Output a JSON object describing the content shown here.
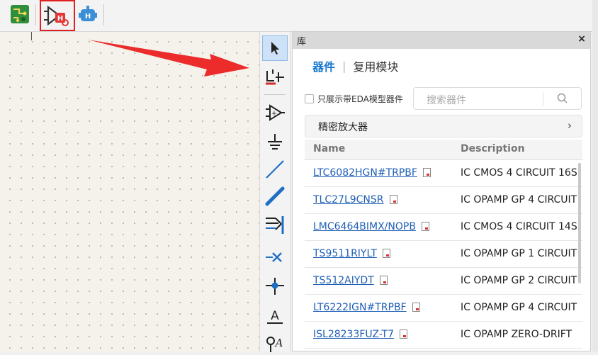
{
  "toolbar": {
    "items": [
      {
        "name": "pcb-board-icon",
        "selected": false
      },
      {
        "name": "schematic-library-icon",
        "selected": true,
        "highlight_color": "#e02020"
      },
      {
        "name": "robot-helper-icon",
        "selected": false
      }
    ]
  },
  "vertical_tools": [
    "select-arrow-icon",
    "bus-entry-icon",
    "add-symbol-icon",
    "ground-power-icon",
    "wire-icon",
    "bus-icon",
    "bus-entry-multi-icon",
    "no-connect-icon",
    "junction-icon",
    "text-label-icon",
    "net-label-icon"
  ],
  "panel": {
    "title": "库",
    "close_label": "×",
    "tabs": {
      "active": "器件",
      "separator": "|",
      "inactive": "复用模块"
    },
    "checkbox_label": "只展示带EDA模型器件",
    "checkbox_checked": false,
    "search_placeholder": "搜索器件",
    "category": {
      "label": "精密放大器",
      "chevron": "›"
    },
    "table": {
      "headers": {
        "name": "Name",
        "description": "Description"
      },
      "rows": [
        {
          "name": "LTC6082HGN#TRPBF",
          "description": "IC CMOS 4 CIRCUIT 16S"
        },
        {
          "name": "TLC27L9CNSR",
          "description": "IC OPAMP GP 4 CIRCUIT"
        },
        {
          "name": "LMC6464BIMX/NOPB",
          "description": "IC CMOS 4 CIRCUIT 14S"
        },
        {
          "name": "TS9511RIYLT",
          "description": "IC OPAMP GP 1 CIRCUIT"
        },
        {
          "name": "TS512AIYDT",
          "description": "IC OPAMP GP 2 CIRCUIT"
        },
        {
          "name": "LT6222IGN#TRPBF",
          "description": "IC OPAMP GP 4 CIRCUIT"
        },
        {
          "name": "ISL28233FUZ-T7",
          "description": "IC OPAMP ZERO-DRIFT"
        }
      ]
    }
  },
  "colors": {
    "accent": "#1677cf",
    "link": "#1f5fb5",
    "annotation_red": "#e02020"
  }
}
